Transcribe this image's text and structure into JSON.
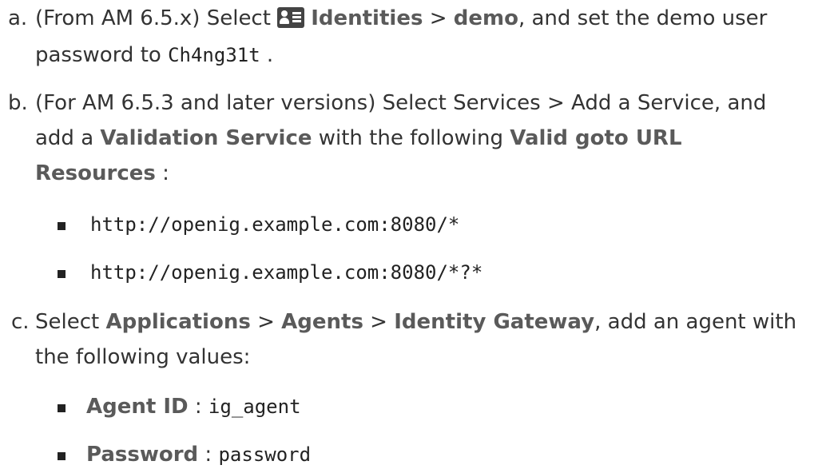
{
  "steps": [
    {
      "marker": "a.",
      "line1_prefix": "(From AM 6.5.x) Select ",
      "icon": "id-card-icon",
      "bold1": "Identities",
      "sep1": " > ",
      "bold2": "demo",
      "line1_suffix": ", and set the demo user",
      "line2_prefix": "password to ",
      "code": "Ch4ng31t",
      "line2_suffix": " ."
    },
    {
      "marker": "b.",
      "line1": "(For AM 6.5.3 and later versions) Select Services > Add a Service, and",
      "line2_prefix": "add a ",
      "bold1": "Validation Service",
      "line2_mid": " with the following ",
      "bold2": "Valid goto URL",
      "bold3": "Resources",
      "line3_suffix": " :",
      "urls": [
        "http://openig.example.com:8080/*",
        "http://openig.example.com:8080/*?*"
      ]
    },
    {
      "marker": "c.",
      "prefix": "Select ",
      "bold1": "Applications",
      "sep1": " > ",
      "bold2": "Agents",
      "sep2": " > ",
      "bold3": "Identity Gateway",
      "line1_suffix": ", add an agent with",
      "line2": "the following values:",
      "values": [
        {
          "label": "Agent ID",
          "sep": " : ",
          "value": "ig_agent"
        },
        {
          "label": "Password",
          "sep": " : ",
          "value": "password"
        }
      ]
    }
  ]
}
